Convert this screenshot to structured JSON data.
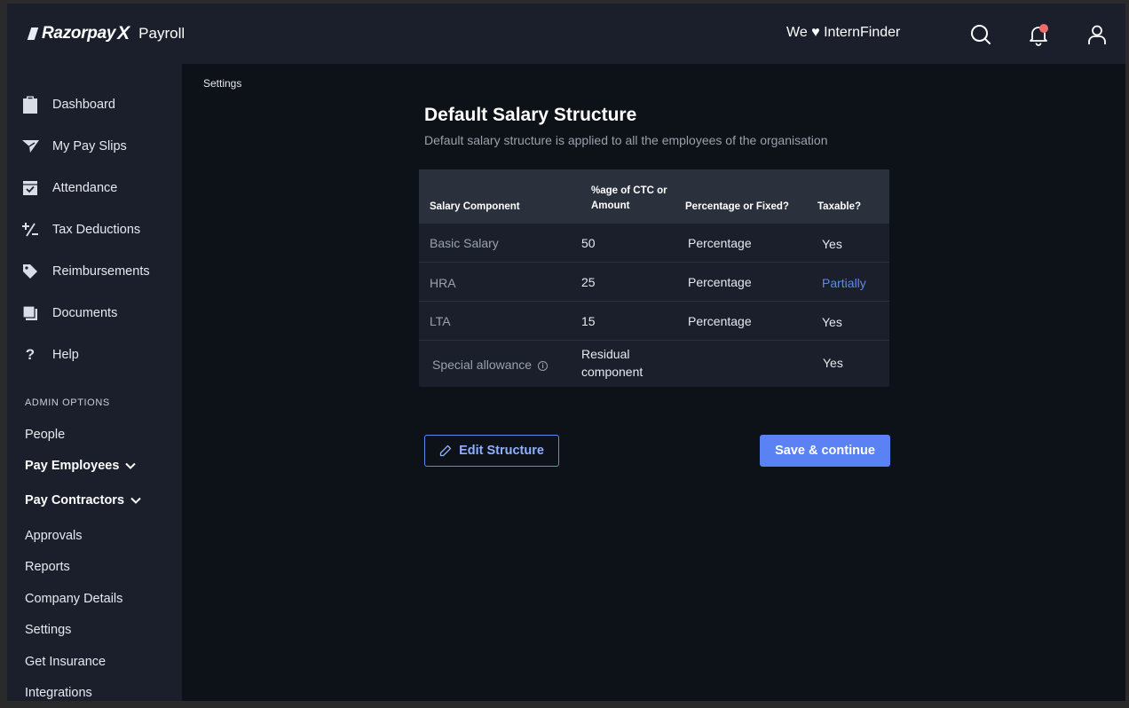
{
  "header": {
    "brand": "Razorpay",
    "brand_x": "X",
    "product": "Payroll",
    "org_name": "We ♥ InternFinder"
  },
  "sidebar": {
    "items": [
      {
        "label": "Dashboard",
        "icon": "clipboard-icon"
      },
      {
        "label": "My Pay Slips",
        "icon": "paper-plane-icon"
      },
      {
        "label": "Attendance",
        "icon": "calendar-check-icon"
      },
      {
        "label": "Tax Deductions",
        "icon": "plus-minus-icon"
      },
      {
        "label": "Reimbursements",
        "icon": "tag-icon"
      },
      {
        "label": "Documents",
        "icon": "documents-icon"
      },
      {
        "label": "Help",
        "icon": "question-icon"
      }
    ],
    "admin_section_label": "ADMIN OPTIONS",
    "admin_items": [
      {
        "label": "People"
      },
      {
        "label": "Pay Employees"
      },
      {
        "label": "Pay Contractors"
      },
      {
        "label": "Approvals"
      },
      {
        "label": "Reports"
      },
      {
        "label": "Company Details"
      },
      {
        "label": "Settings"
      },
      {
        "label": "Get Insurance"
      },
      {
        "label": "Integrations"
      }
    ]
  },
  "main": {
    "breadcrumb": "Settings",
    "title": "Default Salary Structure",
    "subtitle": "Default salary structure is applied to all the employees of the organisation",
    "table": {
      "headers": {
        "component": "Salary Component",
        "amount": "%age of CTC or Amount",
        "type": "Percentage or Fixed?",
        "taxable": "Taxable?"
      },
      "rows": [
        {
          "component": "Basic Salary",
          "amount": "50",
          "type": "Percentage",
          "taxable": "Yes"
        },
        {
          "component": "HRA",
          "amount": "25",
          "type": "Percentage",
          "taxable": "Partially"
        },
        {
          "component": "LTA",
          "amount": "15",
          "type": "Percentage",
          "taxable": "Yes"
        },
        {
          "component": "Special allowance",
          "amount": "Residual component",
          "type": "",
          "taxable": "Yes"
        }
      ]
    },
    "edit_button": "Edit Structure",
    "save_button": "Save & continue"
  },
  "colors": {
    "accent": "#5a82f5",
    "link": "#5f88f5",
    "notification": "#f26b6b",
    "sidebar_bg": "#1a1f2b",
    "main_bg": "#0d1118"
  }
}
